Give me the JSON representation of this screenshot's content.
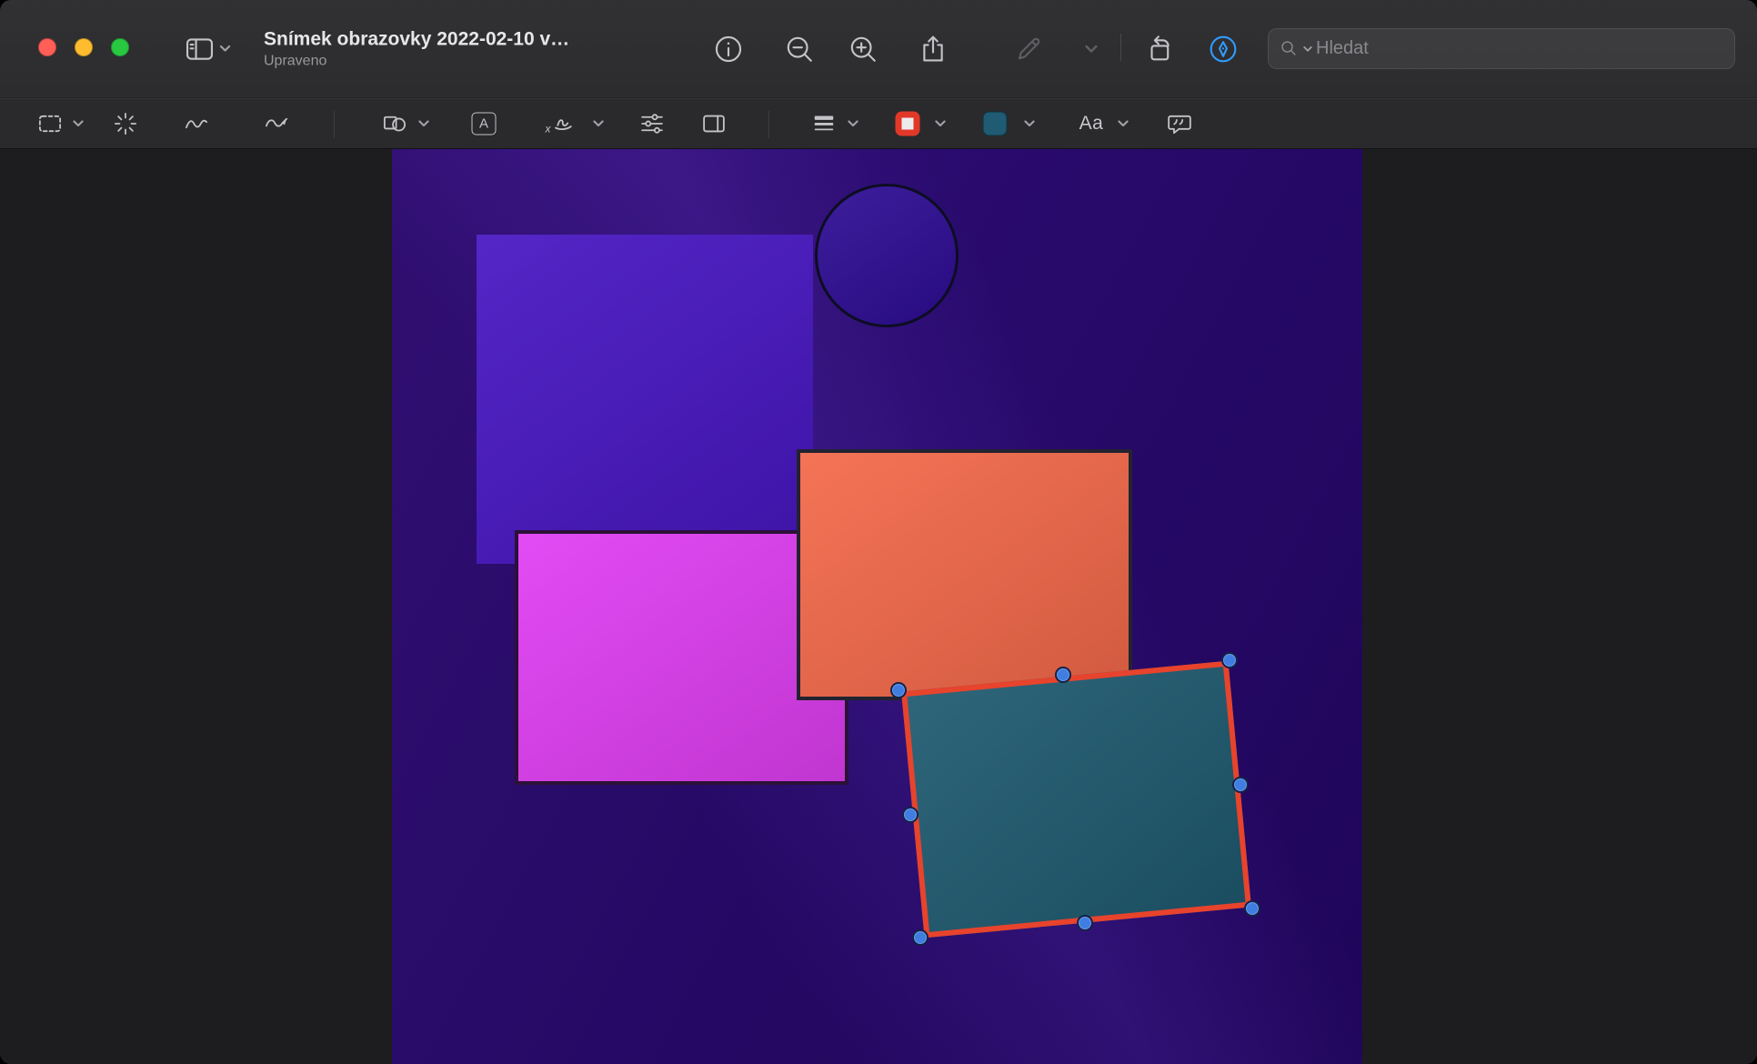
{
  "window": {
    "title": "Snímek obrazovky 2022-02-10 v…",
    "subtitle": "Upraveno",
    "traffic_lights": {
      "close": "#ff5f57",
      "minimize": "#febc2e",
      "zoom": "#28c840"
    },
    "accent_blue": "#2f9bff"
  },
  "titlebar": {
    "search": {
      "placeholder": "Hledat"
    }
  },
  "markup_toolbar": {
    "text_tool_label": "A",
    "signature_label": "x",
    "font_label": "Aa",
    "border_color_swatch": "#e2382a",
    "fill_color_swatch": "#1f5b72"
  },
  "canvas": {
    "image_background": {
      "top": "#36117f",
      "mid": "#2a0a71",
      "bottom": "#21055e"
    },
    "shapes": {
      "square": {
        "fill": "#4716c2"
      },
      "circle": {
        "fill": "#2e0d95",
        "stroke": "#0d0d22"
      },
      "magenta_rect": {
        "fill": "#e03ef3",
        "stroke": "#2b1138"
      },
      "orange_rect": {
        "fill": "#f4694a",
        "stroke": "#23232f"
      },
      "selected_rect": {
        "fill": "#1f5a70",
        "stroke": "#e8432c",
        "handle": "#3f7de0"
      }
    }
  }
}
